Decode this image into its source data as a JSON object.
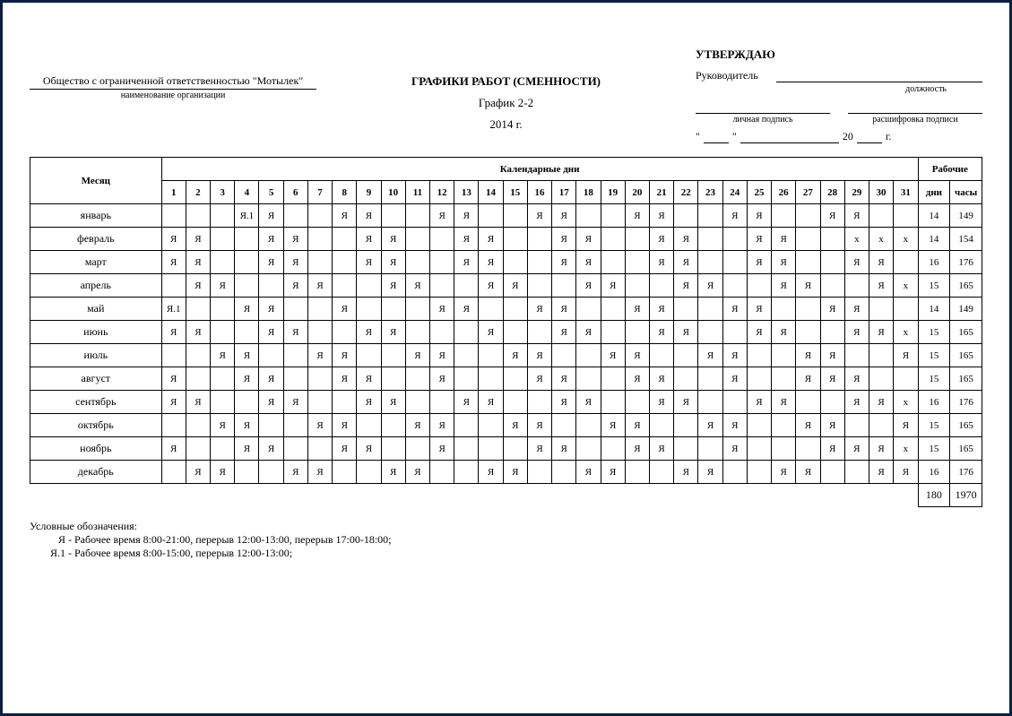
{
  "org": {
    "name": "Общество с ограниченной ответственностью \"Мотылек\"",
    "sub": "наименование организации"
  },
  "title": {
    "main": "ГРАФИКИ РАБОТ (СМЕННОСТИ)",
    "sub": "График 2-2",
    "year": "2014 г."
  },
  "approve": {
    "title": "УТВЕРЖДАЮ",
    "lead": "Руководитель",
    "position_sub": "должность",
    "sig_sub": "личная подпись",
    "decode_sub": "расшифровка подписи",
    "quote_open": "\"",
    "quote_close": "\"",
    "year_prefix": "20",
    "year_suffix": "г."
  },
  "table": {
    "month_header": "Месяц",
    "cal_header": "Календарные дни",
    "work_header": "Рабочие",
    "days_label": "дни",
    "hours_label": "часы",
    "day_nums": [
      "1",
      "2",
      "3",
      "4",
      "5",
      "6",
      "7",
      "8",
      "9",
      "10",
      "11",
      "12",
      "13",
      "14",
      "15",
      "16",
      "17",
      "18",
      "19",
      "20",
      "21",
      "22",
      "23",
      "24",
      "25",
      "26",
      "27",
      "28",
      "29",
      "30",
      "31"
    ],
    "rows": [
      {
        "month": "январь",
        "cells": [
          "",
          "",
          "",
          "Я.1",
          "Я",
          "",
          "",
          "Я",
          "Я",
          "",
          "",
          "Я",
          "Я",
          "",
          "",
          "Я",
          "Я",
          "",
          "",
          "Я",
          "Я",
          "",
          "",
          "Я",
          "Я",
          "",
          "",
          "Я",
          "Я",
          "",
          ""
        ],
        "days": "14",
        "hours": "149"
      },
      {
        "month": "февраль",
        "cells": [
          "Я",
          "Я",
          "",
          "",
          "Я",
          "Я",
          "",
          "",
          "Я",
          "Я",
          "",
          "",
          "Я",
          "Я",
          "",
          "",
          "Я",
          "Я",
          "",
          "",
          "Я",
          "Я",
          "",
          "",
          "Я",
          "Я",
          "",
          "",
          "x",
          "x",
          "x"
        ],
        "days": "14",
        "hours": "154"
      },
      {
        "month": "март",
        "cells": [
          "Я",
          "Я",
          "",
          "",
          "Я",
          "Я",
          "",
          "",
          "Я",
          "Я",
          "",
          "",
          "Я",
          "Я",
          "",
          "",
          "Я",
          "Я",
          "",
          "",
          "Я",
          "Я",
          "",
          "",
          "Я",
          "Я",
          "",
          "",
          "Я",
          "Я",
          ""
        ],
        "days": "16",
        "hours": "176"
      },
      {
        "month": "апрель",
        "cells": [
          "",
          "Я",
          "Я",
          "",
          "",
          "Я",
          "Я",
          "",
          "",
          "Я",
          "Я",
          "",
          "",
          "Я",
          "Я",
          "",
          "",
          "Я",
          "Я",
          "",
          "",
          "Я",
          "Я",
          "",
          "",
          "Я",
          "Я",
          "",
          "",
          "Я",
          "x"
        ],
        "days": "15",
        "hours": "165"
      },
      {
        "month": "май",
        "cells": [
          "Я.1",
          "",
          "",
          "Я",
          "Я",
          "",
          "",
          "Я",
          "",
          "",
          "",
          "Я",
          "Я",
          "",
          "",
          "Я",
          "Я",
          "",
          "",
          "Я",
          "Я",
          "",
          "",
          "Я",
          "Я",
          "",
          "",
          "Я",
          "Я",
          "",
          ""
        ],
        "days": "14",
        "hours": "149"
      },
      {
        "month": "июнь",
        "cells": [
          "Я",
          "Я",
          "",
          "",
          "Я",
          "Я",
          "",
          "",
          "Я",
          "Я",
          "",
          "",
          "",
          "Я",
          "",
          "",
          "Я",
          "Я",
          "",
          "",
          "Я",
          "Я",
          "",
          "",
          "Я",
          "Я",
          "",
          "",
          "Я",
          "Я",
          "x"
        ],
        "days": "15",
        "hours": "165"
      },
      {
        "month": "июль",
        "cells": [
          "",
          "",
          "Я",
          "Я",
          "",
          "",
          "Я",
          "Я",
          "",
          "",
          "Я",
          "Я",
          "",
          "",
          "Я",
          "Я",
          "",
          "",
          "Я",
          "Я",
          "",
          "",
          "Я",
          "Я",
          "",
          "",
          "Я",
          "Я",
          "",
          "",
          "Я"
        ],
        "days": "15",
        "hours": "165"
      },
      {
        "month": "август",
        "cells": [
          "Я",
          "",
          "",
          "Я",
          "Я",
          "",
          "",
          "Я",
          "Я",
          "",
          "",
          "Я",
          "",
          "",
          "",
          "Я",
          "Я",
          "",
          "",
          "Я",
          "Я",
          "",
          "",
          "Я",
          "",
          "",
          "Я",
          "Я",
          "Я",
          "",
          ""
        ],
        "days": "15",
        "hours": "165"
      },
      {
        "month": "сентябрь",
        "cells": [
          "Я",
          "Я",
          "",
          "",
          "Я",
          "Я",
          "",
          "",
          "Я",
          "Я",
          "",
          "",
          "Я",
          "Я",
          "",
          "",
          "Я",
          "Я",
          "",
          "",
          "Я",
          "Я",
          "",
          "",
          "Я",
          "Я",
          "",
          "",
          "Я",
          "Я",
          "x"
        ],
        "days": "16",
        "hours": "176"
      },
      {
        "month": "октябрь",
        "cells": [
          "",
          "",
          "Я",
          "Я",
          "",
          "",
          "Я",
          "Я",
          "",
          "",
          "Я",
          "Я",
          "",
          "",
          "Я",
          "Я",
          "",
          "",
          "Я",
          "Я",
          "",
          "",
          "Я",
          "Я",
          "",
          "",
          "Я",
          "Я",
          "",
          "",
          "Я"
        ],
        "days": "15",
        "hours": "165"
      },
      {
        "month": "ноябрь",
        "cells": [
          "Я",
          "",
          "",
          "Я",
          "Я",
          "",
          "",
          "Я",
          "Я",
          "",
          "",
          "Я",
          "",
          "",
          "",
          "Я",
          "Я",
          "",
          "",
          "Я",
          "Я",
          "",
          "",
          "Я",
          "",
          "",
          "",
          "Я",
          "Я",
          "Я",
          "x"
        ],
        "days": "15",
        "hours": "165"
      },
      {
        "month": "декабрь",
        "cells": [
          "",
          "Я",
          "Я",
          "",
          "",
          "Я",
          "Я",
          "",
          "",
          "Я",
          "Я",
          "",
          "",
          "Я",
          "Я",
          "",
          "",
          "Я",
          "Я",
          "",
          "",
          "Я",
          "Я",
          "",
          "",
          "Я",
          "Я",
          "",
          "",
          "Я",
          "Я"
        ],
        "days": "16",
        "hours": "176"
      }
    ],
    "total_days": "180",
    "total_hours": "1970"
  },
  "legend": {
    "header": "Условные обозначения:",
    "items": [
      {
        "code": "Я",
        "text": "Рабочее время 8:00-21:00, перерыв 12:00-13:00, перерыв 17:00-18:00;"
      },
      {
        "code": "Я.1",
        "text": "Рабочее время 8:00-15:00, перерыв 12:00-13:00;"
      }
    ]
  }
}
